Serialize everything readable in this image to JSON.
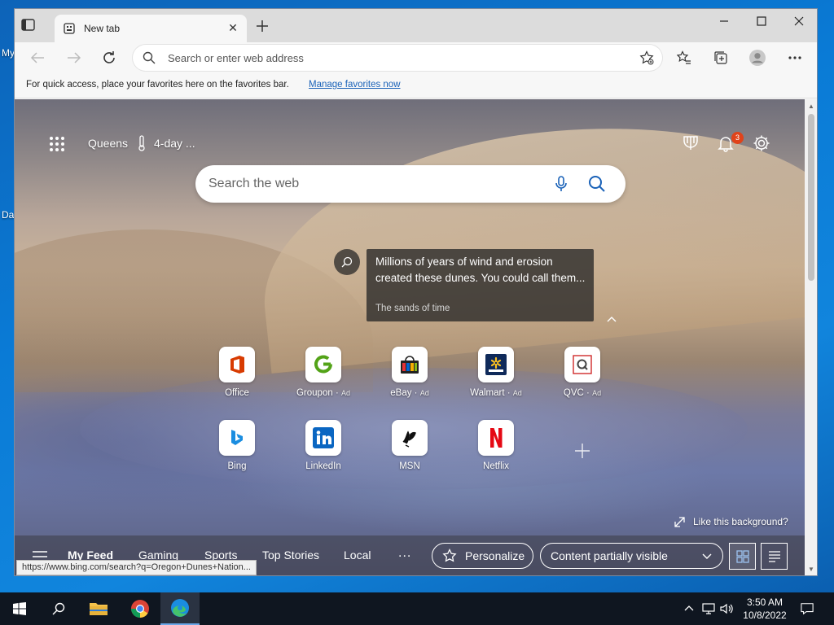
{
  "desktop": {
    "icon_labels": [
      "My",
      "Da"
    ]
  },
  "browser": {
    "tab": {
      "title": "New tab"
    },
    "address": {
      "placeholder": "Search or enter web address"
    },
    "favorites_bar": {
      "message": "For quick access, place your favorites here on the favorites bar.",
      "link": "Manage favorites now"
    }
  },
  "newtab": {
    "location": "Queens",
    "weather": "4-day ...",
    "notification_count": "3",
    "search_placeholder": "Search the web",
    "background_info": {
      "title": "Millions of years of wind and erosion created these dunes. You could call them...",
      "subtitle": "The sands of time"
    },
    "tiles": [
      {
        "label": "Office",
        "ad": "",
        "icon": "office-icon"
      },
      {
        "label": "Groupon",
        "ad": "Ad",
        "icon": "groupon-icon"
      },
      {
        "label": "eBay",
        "ad": "Ad",
        "icon": "ebay-icon"
      },
      {
        "label": "Walmart",
        "ad": "Ad",
        "icon": "walmart-icon"
      },
      {
        "label": "QVC",
        "ad": "Ad",
        "icon": "qvc-icon"
      },
      {
        "label": "Bing",
        "ad": "",
        "icon": "bing-icon"
      },
      {
        "label": "LinkedIn",
        "ad": "",
        "icon": "linkedin-icon"
      },
      {
        "label": "MSN",
        "ad": "",
        "icon": "msn-icon"
      },
      {
        "label": "Netflix",
        "ad": "",
        "icon": "netflix-icon"
      }
    ],
    "like_background": "Like this background?",
    "feed": {
      "tabs": [
        "My Feed",
        "Gaming",
        "Sports",
        "Top Stories",
        "Local"
      ],
      "more": "...",
      "personalize": "Personalize",
      "content_visibility": "Content partially visible"
    },
    "status_url": "https://www.bing.com/search?q=Oregon+Dunes+Nation..."
  },
  "taskbar": {
    "time": "3:50 AM",
    "date": "10/8/2022"
  },
  "colors": {
    "accent": "#0a6fc2",
    "badge": "#e0431a",
    "netflix": "#e50914",
    "linkedin": "#0a66c2"
  }
}
